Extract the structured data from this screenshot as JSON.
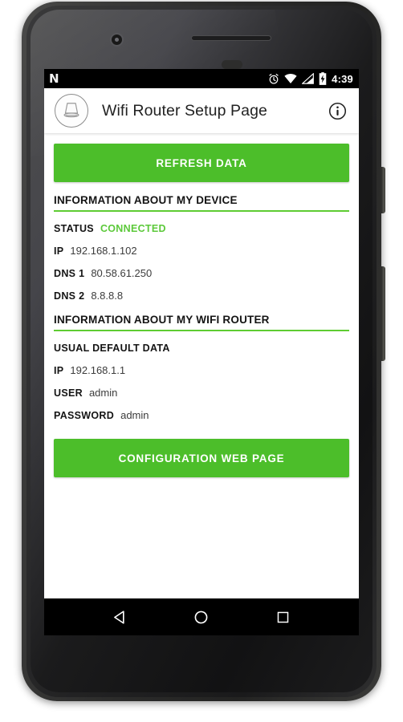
{
  "status_bar": {
    "left_icon": "android-nougat-n-icon",
    "icons": [
      "alarm-icon",
      "wifi-icon",
      "cell-signal-icon",
      "battery-charging-icon"
    ],
    "time": "4:39"
  },
  "toolbar": {
    "logo_icon": "router-logo-icon",
    "title": "Wifi Router Setup Page",
    "info_icon": "info-icon",
    "info_label": "i"
  },
  "colors": {
    "primary_green": "#4CBE2A",
    "accent_green": "#5ECC32",
    "status_green": "#5CC93A",
    "text_dark": "#141414",
    "value_grey": "#3C3C3C"
  },
  "main": {
    "refresh_button": "REFRESH DATA",
    "config_button": "CONFIGURATION WEB PAGE",
    "device_section": {
      "header": "INFORMATION ABOUT MY DEVICE",
      "rows": [
        {
          "label": "STATUS",
          "value": "CONNECTED",
          "accent": true
        },
        {
          "label": "IP",
          "value": "192.168.1.102",
          "accent": false
        },
        {
          "label": "DNS 1",
          "value": "80.58.61.250",
          "accent": false
        },
        {
          "label": "DNS 2",
          "value": "8.8.8.8",
          "accent": false
        }
      ]
    },
    "router_section": {
      "header": "INFORMATION ABOUT MY WIFI ROUTER",
      "subhead": "USUAL DEFAULT DATA",
      "rows": [
        {
          "label": "IP",
          "value": "192.168.1.1"
        },
        {
          "label": "USER",
          "value": "admin"
        },
        {
          "label": "PASSWORD",
          "value": "admin"
        }
      ]
    }
  },
  "nav_bar": {
    "keys": [
      {
        "name": "back-button",
        "icon": "back-triangle-icon"
      },
      {
        "name": "home-button",
        "icon": "home-circle-icon"
      },
      {
        "name": "recents-button",
        "icon": "recents-square-icon"
      }
    ]
  }
}
